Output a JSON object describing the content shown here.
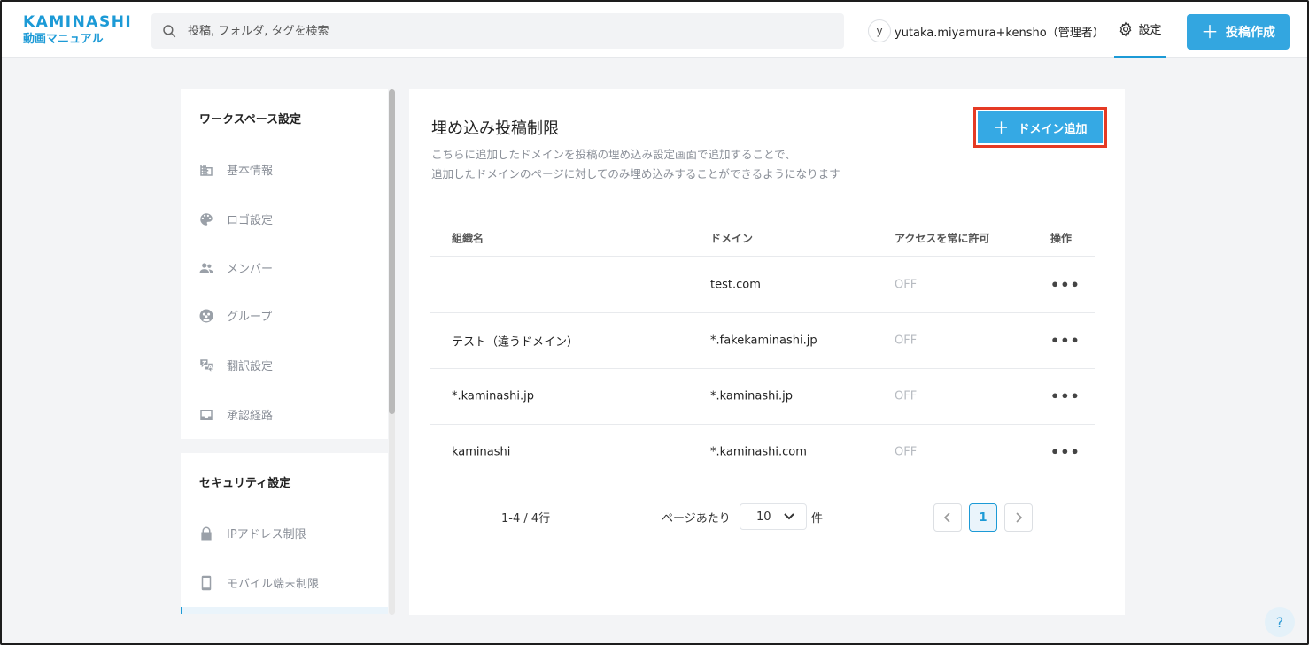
{
  "header": {
    "brand": "KAMINASHI",
    "brand_sub": "動画マニュアル",
    "search_placeholder": "投稿, フォルダ, タグを検索",
    "avatar_initial": "y",
    "username": "yutaka.miyamura+kensho（管理者）",
    "settings_label": "設定",
    "post_button": "投稿作成",
    "accent": "#1c9ad6"
  },
  "sidebar": {
    "workspace_title": "ワークスペース設定",
    "workspace_items": [
      {
        "label": "基本情報",
        "icon": "building-icon"
      },
      {
        "label": "ロゴ設定",
        "icon": "palette-icon"
      },
      {
        "label": "メンバー",
        "icon": "people-icon"
      },
      {
        "label": "グループ",
        "icon": "group-icon"
      },
      {
        "label": "翻訳設定",
        "icon": "translate-icon"
      },
      {
        "label": "承認経路",
        "icon": "inbox-icon"
      }
    ],
    "security_title": "セキュリティ設定",
    "security_items": [
      {
        "label": "IPアドレス制限",
        "icon": "lock-icon"
      },
      {
        "label": "モバイル端末制限",
        "icon": "phone-icon"
      }
    ]
  },
  "main": {
    "title": "埋め込み投稿制限",
    "desc_line1": "こちらに追加したドメインを投稿の埋め込み設定画面で追加することで、",
    "desc_line2": "追加したドメインのページに対してのみ埋め込みすることができるようになります",
    "add_button": "ドメイン追加",
    "columns": [
      "組織名",
      "ドメイン",
      "アクセスを常に許可",
      "操作"
    ],
    "rows": [
      {
        "org": "",
        "domain": "test.com",
        "access": "OFF",
        "ops": "•••"
      },
      {
        "org": "テスト（違うドメイン）",
        "domain": "*.fakekaminashi.jp",
        "access": "OFF",
        "ops": "•••"
      },
      {
        "org": "*.kaminashi.jp",
        "domain": "*.kaminashi.jp",
        "access": "OFF",
        "ops": "•••"
      },
      {
        "org": "kaminashi",
        "domain": "*.kaminashi.com",
        "access": "OFF",
        "ops": "•••"
      }
    ],
    "pager": {
      "count": "1-4 / 4行",
      "per_page_label": "ページあたり",
      "per_page_value": "10",
      "unit": "件",
      "current_page": "1"
    }
  },
  "help_label": "?"
}
